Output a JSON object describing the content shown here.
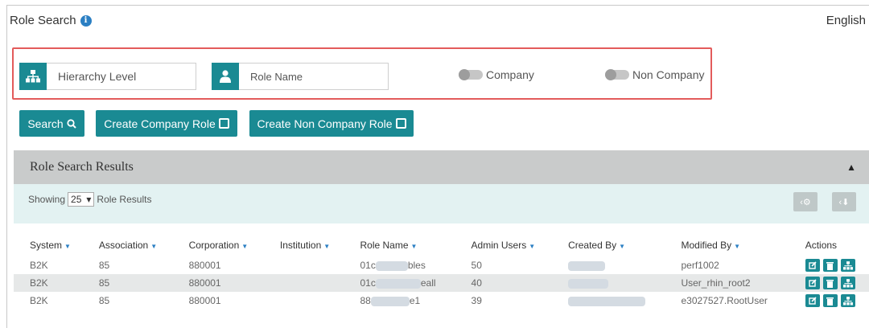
{
  "header": {
    "title": "Role Search",
    "language": "English"
  },
  "filters": {
    "hierarchy_placeholder": "Hierarchy Level",
    "role_name_placeholder": "Role Name",
    "toggle_company": "Company",
    "toggle_non_company": "Non Company"
  },
  "buttons": {
    "search": "Search",
    "create_company_role": "Create Company Role",
    "create_non_company_role": "Create Non Company Role"
  },
  "results": {
    "title": "Role Search Results",
    "showing_prefix": "Showing",
    "page_size": "25",
    "showing_suffix": "Role Results"
  },
  "table": {
    "columns": [
      "System",
      "Association",
      "Corporation",
      "Institution",
      "Role Name",
      "Admin Users",
      "Created By",
      "Modified By",
      "Actions"
    ],
    "rows": [
      {
        "system": "B2K",
        "association": "85",
        "corporation": "880001",
        "institution": "",
        "role_name_start": "01c",
        "role_name_end": "bles",
        "admin_users": "50",
        "modified_by": "perf1002"
      },
      {
        "system": "B2K",
        "association": "85",
        "corporation": "880001",
        "institution": "",
        "role_name_start": "01c",
        "role_name_end": "eall",
        "admin_users": "40",
        "modified_by": "User_rhin_root2"
      },
      {
        "system": "B2K",
        "association": "85",
        "corporation": "880001",
        "institution": "",
        "role_name_start": "88",
        "role_name_end": "e1",
        "admin_users": "39",
        "modified_by": "e3027527.RootUser"
      }
    ]
  },
  "colors": {
    "accent": "#1a8a93",
    "highlight_border": "#e35b5b",
    "panel_header": "#c9cbcb",
    "panel_sub": "#e3f2f2"
  }
}
